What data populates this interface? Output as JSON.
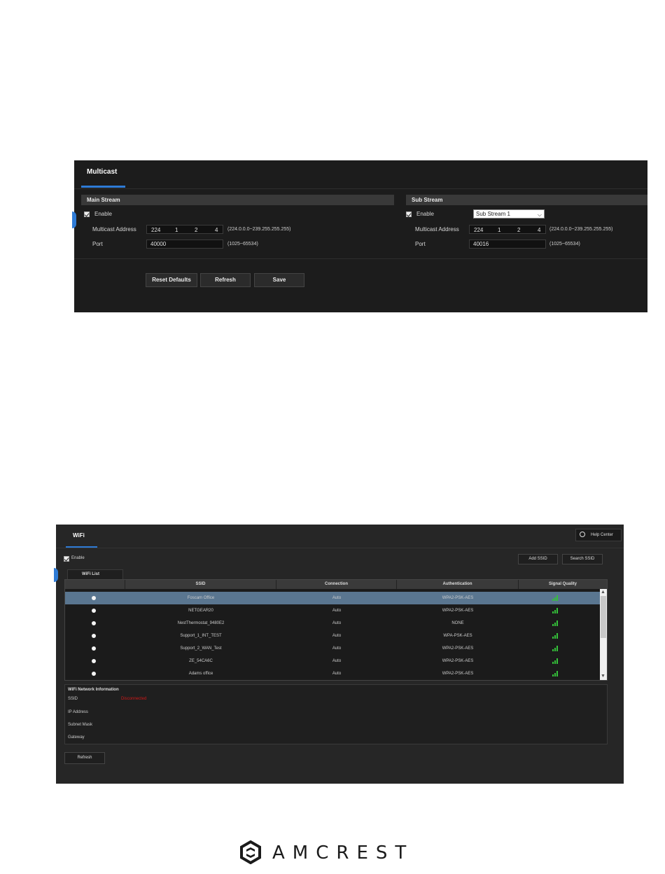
{
  "multicast": {
    "tab_label": "Multicast",
    "main_stream": {
      "header": "Main Stream",
      "enable_label": "Enable",
      "enable_checked": true,
      "multicast_address_label": "Multicast Address",
      "ip": [
        "224",
        "1",
        "2",
        "4"
      ],
      "ip_range_hint": "(224.0.0.0~239.255.255.255)",
      "port_label": "Port",
      "port_value": "40000",
      "port_range_hint": "(1025~65534)"
    },
    "sub_stream": {
      "header": "Sub Stream",
      "enable_label": "Enable",
      "enable_checked": true,
      "stream_select": "Sub Stream 1",
      "multicast_address_label": "Multicast Address",
      "ip": [
        "224",
        "1",
        "2",
        "4"
      ],
      "ip_range_hint": "(224.0.0.0~239.255.255.255)",
      "port_label": "Port",
      "port_value": "40016",
      "port_range_hint": "(1025~65534)"
    },
    "buttons": {
      "reset": "Reset Defaults",
      "refresh": "Refresh",
      "save": "Save"
    }
  },
  "wifi": {
    "tab_label": "WiFi",
    "help_center": "Help Center",
    "enable_label": "Enable",
    "add_ssid": "Add SSID",
    "search_ssid": "Search SSID",
    "list_tab": "WiFi List",
    "columns": [
      "SSID",
      "Connection",
      "Authentication",
      "Signal Quality"
    ],
    "rows": [
      {
        "ssid": "Foscam Office",
        "connection": "Auto",
        "auth": "WPA2-PSK-AES",
        "selected": true
      },
      {
        "ssid": "NETGEAR20",
        "connection": "Auto",
        "auth": "WPA2-PSK-AES",
        "selected": false
      },
      {
        "ssid": "NestThermostat_9480E2",
        "connection": "Auto",
        "auth": "NONE",
        "selected": false
      },
      {
        "ssid": "Support_1_INT_TEST",
        "connection": "Auto",
        "auth": "WPA-PSK-AES",
        "selected": false
      },
      {
        "ssid": "Support_2_WAN_Test",
        "connection": "Auto",
        "auth": "WPA2-PSK-AES",
        "selected": false
      },
      {
        "ssid": "ZE_54CA6C",
        "connection": "Auto",
        "auth": "WPA2-PSK-AES",
        "selected": false
      },
      {
        "ssid": "Adams office",
        "connection": "Auto",
        "auth": "WPA2-PSK-AES",
        "selected": false
      }
    ],
    "network_info": {
      "title": "WiFi Network Information",
      "ssid_label": "SSID",
      "ssid_value": "Disconnected",
      "ip_label": "IP Address",
      "mask_label": "Subnet Mask",
      "gateway_label": "Gateway"
    },
    "refresh": "Refresh"
  },
  "logo": {
    "brand": "AMCREST"
  },
  "colors": {
    "accent": "#2e7bd6",
    "signal": "#35c23a",
    "error": "#d01818"
  }
}
